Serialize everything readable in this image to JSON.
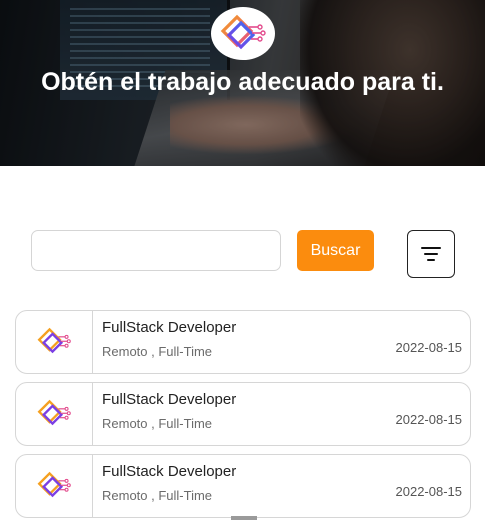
{
  "hero": {
    "title": "Obtén el trabajo adecuado para ti.",
    "logo_icon": "diamond-circuit-logo-icon"
  },
  "search": {
    "value": "",
    "placeholder": "",
    "button_label": "Buscar",
    "filter_icon": "filter-icon"
  },
  "jobs": [
    {
      "title": "FullStack Developer",
      "meta": "Remoto , Full-Time",
      "date": "2022-08-15",
      "logo_icon": "diamond-circuit-logo-icon"
    },
    {
      "title": "FullStack Developer",
      "meta": "Remoto , Full-Time",
      "date": "2022-08-15",
      "logo_icon": "diamond-circuit-logo-icon"
    },
    {
      "title": "FullStack Developer",
      "meta": "Remoto , Full-Time",
      "date": "2022-08-15",
      "logo_icon": "diamond-circuit-logo-icon"
    }
  ],
  "colors": {
    "accent": "#fb8c0e",
    "logo_orange": "#f5a020",
    "logo_purple": "#7b3fe4",
    "logo_pink": "#e24a8c"
  }
}
